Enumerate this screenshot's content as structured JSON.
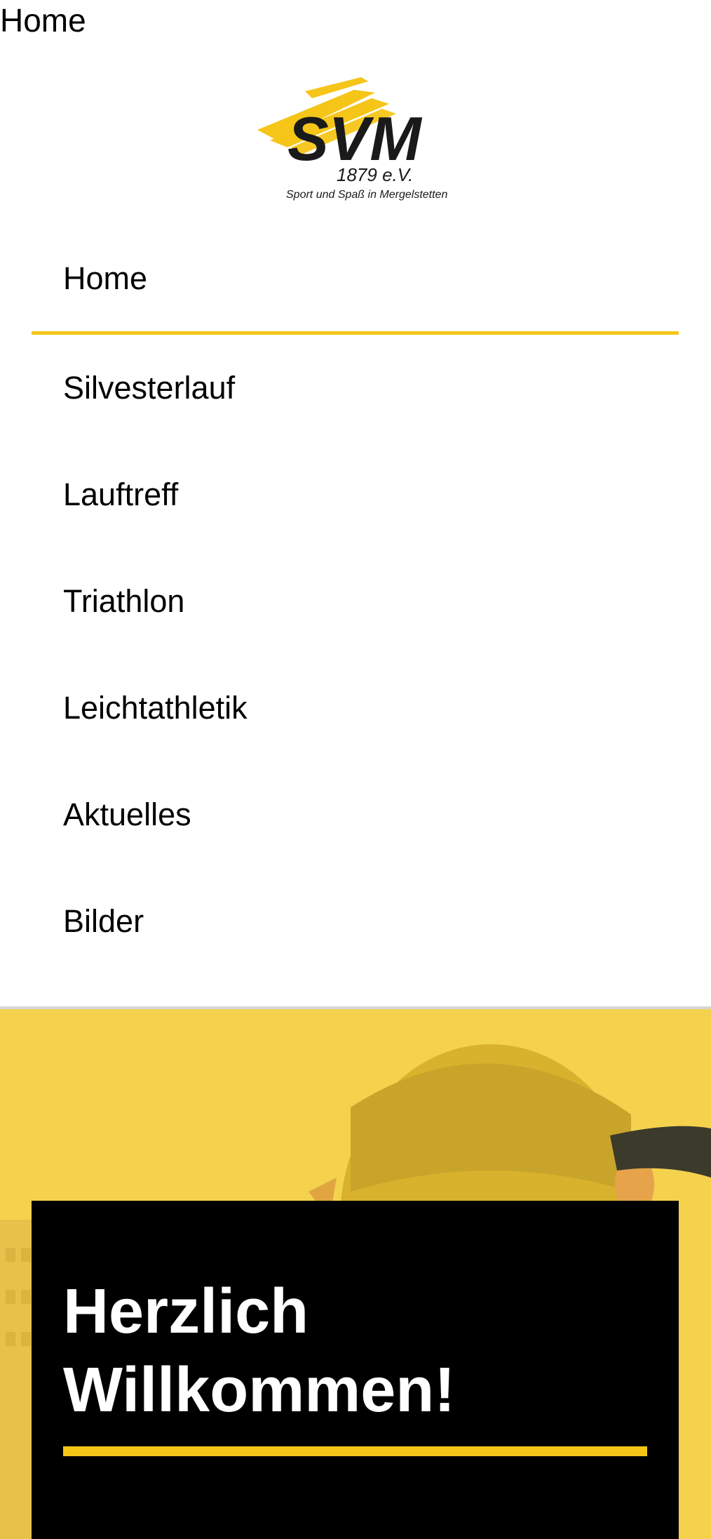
{
  "page": {
    "title": "Home"
  },
  "logo": {
    "name": "SVM",
    "year": "1879 e.V.",
    "tagline": "Sport und Spaß in Mergelstetten",
    "brand_color": "#f5c518"
  },
  "nav": {
    "items": [
      {
        "label": "Home",
        "active": true
      },
      {
        "label": "Silvesterlauf"
      },
      {
        "label": "Lauftreff"
      },
      {
        "label": "Triathlon"
      },
      {
        "label": "Leichtathletik"
      },
      {
        "label": "Aktuelles"
      },
      {
        "label": "Bilder"
      }
    ]
  },
  "hero": {
    "background_color": "#f4d24e",
    "heading_line1": "Herzlich",
    "heading_line2": "Willkommen!"
  }
}
